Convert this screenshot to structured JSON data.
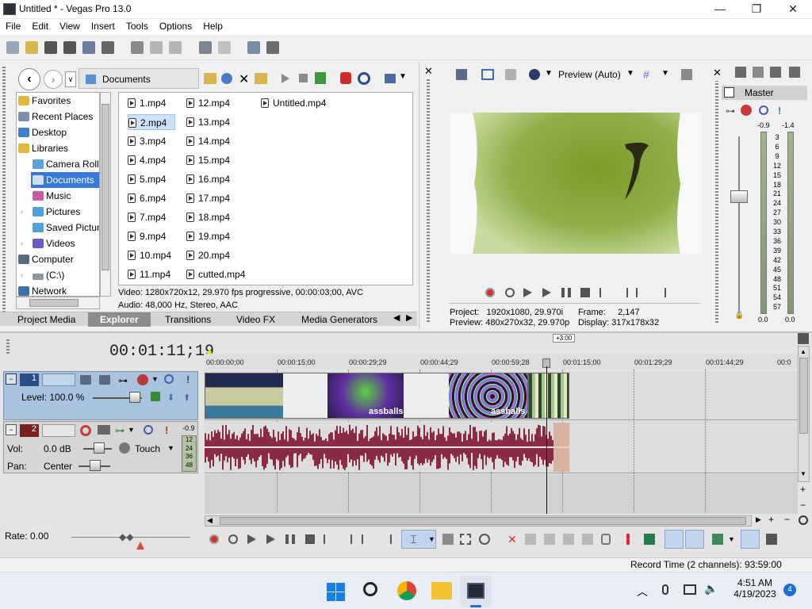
{
  "window": {
    "title": "Untitled * - Vegas Pro 13.0",
    "min": "—",
    "max": "❐",
    "close": "✕"
  },
  "menu": [
    "File",
    "Edit",
    "View",
    "Insert",
    "Tools",
    "Options",
    "Help"
  ],
  "explorer": {
    "location": "Documents",
    "tree": [
      {
        "label": "Favorites",
        "indent": 0
      },
      {
        "label": "Recent Places",
        "indent": 0
      },
      {
        "label": "Desktop",
        "indent": 0
      },
      {
        "label": "Libraries",
        "indent": 0
      },
      {
        "label": "Camera Roll",
        "indent": 1
      },
      {
        "label": "Documents",
        "indent": 1,
        "selected": true
      },
      {
        "label": "Music",
        "indent": 1
      },
      {
        "label": "Pictures",
        "indent": 1
      },
      {
        "label": "Saved Pictur",
        "indent": 1
      },
      {
        "label": "Videos",
        "indent": 1
      },
      {
        "label": "Computer",
        "indent": 0
      },
      {
        "label": "(C:\\)",
        "indent": 1
      },
      {
        "label": "Network",
        "indent": 0
      }
    ],
    "files_col1": [
      "1.mp4",
      "2.mp4",
      "3.mp4",
      "4.mp4",
      "5.mp4",
      "6.mp4",
      "7.mp4",
      "9.mp4",
      "10.mp4",
      "11.mp4"
    ],
    "files_col2": [
      "12.mp4",
      "13.mp4",
      "14.mp4",
      "15.mp4",
      "16.mp4",
      "17.mp4",
      "18.mp4",
      "19.mp4",
      "20.mp4",
      "cutted.mp4"
    ],
    "files_col3": [
      "Untitled.mp4"
    ],
    "selected_file": "2.mp4",
    "info_video": "Video: 1280x720x12, 29.970 fps progressive, 00:00:03;00, AVC",
    "info_audio": "Audio: 48,000 Hz, Stereo, AAC",
    "tabs": [
      "Project Media",
      "Explorer",
      "Transitions",
      "Video FX",
      "Media Generators"
    ],
    "active_tab": "Explorer"
  },
  "preview": {
    "mode": "Preview (Auto)",
    "project_label": "Project:",
    "project_value": "1920x1080, 29.970i",
    "preview_label": "Preview:",
    "preview_value": "480x270x32, 29.970p",
    "frame_label": "Frame:",
    "frame_value": "2,147",
    "display_label": "Display:",
    "display_value": "317x178x32"
  },
  "master": {
    "label": "Master",
    "left_peak": "-0.9",
    "right_peak": "-1.4",
    "scale": [
      "3",
      "6",
      "9",
      "12",
      "15",
      "18",
      "21",
      "24",
      "27",
      "30",
      "33",
      "36",
      "39",
      "42",
      "45",
      "48",
      "51",
      "54",
      "57"
    ],
    "left_value": "0.0",
    "right_value": "0.0"
  },
  "timeline": {
    "time": "00:01:11;19",
    "ruler": [
      "00:00:00;00",
      "00:00:15;00",
      "00:00:29;29",
      "00:00:44;29",
      "00:00:59;28",
      "00:01:15;00",
      "00:01:29;29",
      "00:01:44;29",
      "00:0"
    ],
    "cursor_offset": "+3:00",
    "video_track": {
      "number": "1",
      "level_label": "Level: 100.0 %"
    },
    "audio_track": {
      "number": "2",
      "vol_label": "Vol:",
      "vol_value": "0.0 dB",
      "pan_label": "Pan:",
      "pan_value": "Center",
      "touch_label": "Touch",
      "peak": "-0.9",
      "meter_scale": [
        "12",
        "24",
        "36",
        "48"
      ]
    },
    "clip_labels": [
      "assballs",
      "assballs"
    ],
    "rate": "Rate: 0.00"
  },
  "status": {
    "record_time": "Record Time (2 channels): 93:59:00"
  },
  "taskbar": {
    "time": "4:51 AM",
    "date": "4/19/2023",
    "badge": "4"
  }
}
